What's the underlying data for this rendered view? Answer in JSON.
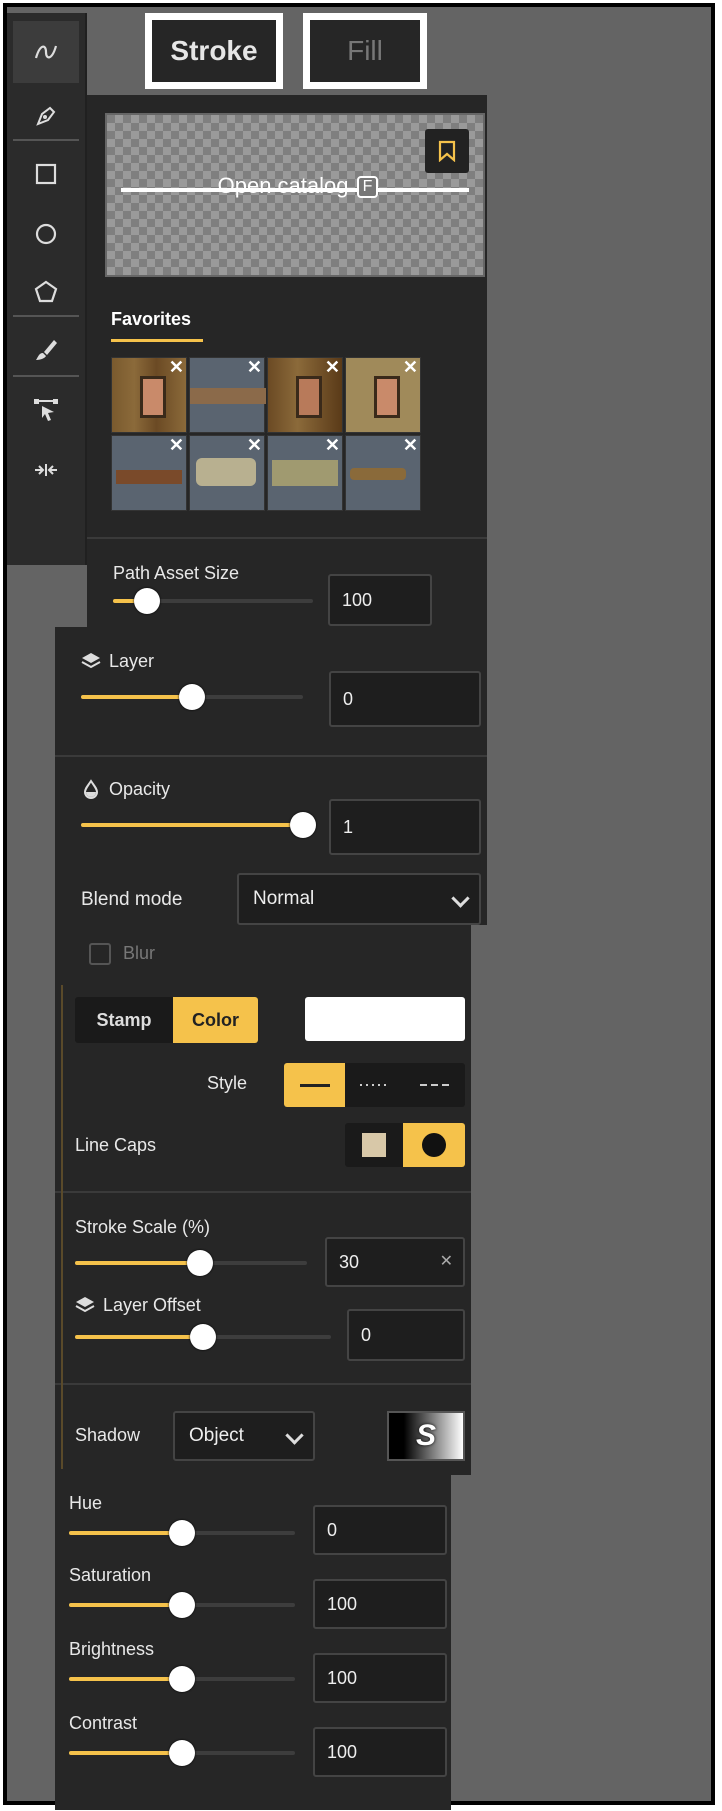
{
  "tabs": {
    "stroke": "Stroke",
    "fill": "Fill"
  },
  "toolbar": {
    "tools": [
      "path-tool",
      "pen-tool",
      "rectangle-tool",
      "ellipse-tool",
      "polygon-tool",
      "brush-tool",
      "select-node-tool",
      "split-tool"
    ],
    "active": "path-tool"
  },
  "catalog": {
    "label": "Open catalog",
    "shortcut": "F"
  },
  "favorites": {
    "title": "Favorites",
    "count_visible": 8,
    "remove_glyph": "✕"
  },
  "path_asset_size": {
    "label": "Path Asset Size",
    "value": "100",
    "fraction": 0.17
  },
  "layer": {
    "label": "Layer",
    "value": "0",
    "fraction": 0.5
  },
  "opacity": {
    "label": "Opacity",
    "value": "1",
    "fraction": 1.0
  },
  "blend": {
    "label": "Blend mode",
    "value": "Normal"
  },
  "blur": {
    "label": "Blur",
    "checked": false
  },
  "source": {
    "stamp": "Stamp",
    "color": "Color",
    "active": "Color",
    "swatch": "#ffffff"
  },
  "style": {
    "label": "Style",
    "options": [
      "solid",
      "dotted",
      "dashed"
    ],
    "active": "solid"
  },
  "line_caps": {
    "label": "Line Caps",
    "options": [
      "square",
      "round"
    ],
    "active": "round"
  },
  "stroke_scale": {
    "label": "Stroke Scale (%)",
    "value": "30",
    "fraction": 0.54,
    "clear": "✕"
  },
  "layer_offset": {
    "label": "Layer Offset",
    "value": "0",
    "fraction": 0.5
  },
  "shadow": {
    "label": "Shadow",
    "value": "Object",
    "preview": "S"
  },
  "hue": {
    "label": "Hue",
    "value": "0",
    "fraction": 0.5
  },
  "saturation": {
    "label": "Saturation",
    "value": "100",
    "fraction": 0.5
  },
  "brightness": {
    "label": "Brightness",
    "value": "100",
    "fraction": 0.5
  },
  "contrast": {
    "label": "Contrast",
    "value": "100",
    "fraction": 0.5
  },
  "colors": {
    "accent": "#f5c24b",
    "panel": "#262626",
    "canvas": "#646464"
  }
}
